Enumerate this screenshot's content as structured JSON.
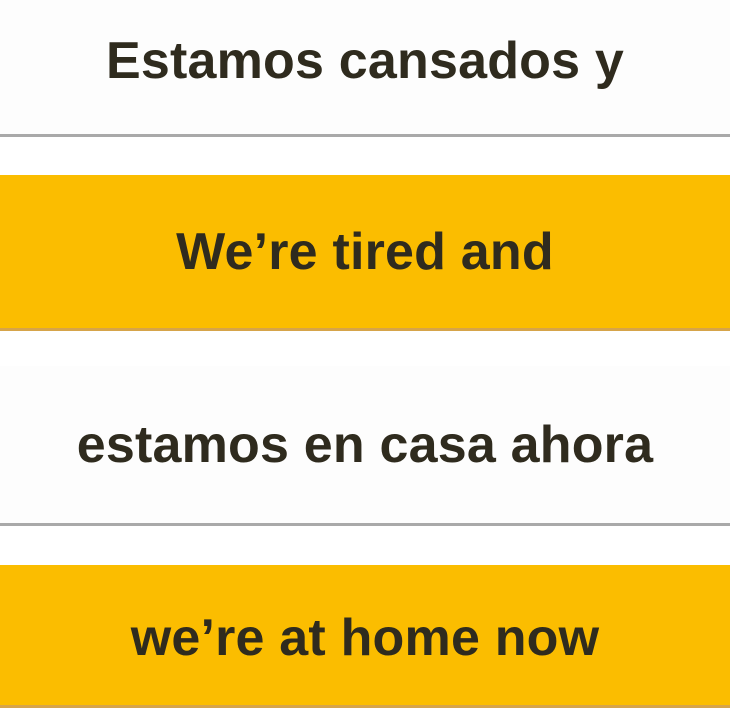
{
  "cards": [
    {
      "text": "Estamos cansados y",
      "color": "#fdfdfd"
    },
    {
      "text": "We’re tired and",
      "color": "#fbbd00"
    },
    {
      "text": "estamos en casa ahora",
      "color": "#fdfdfd"
    },
    {
      "text": "we’re at home now",
      "color": "#fbbd00"
    }
  ]
}
